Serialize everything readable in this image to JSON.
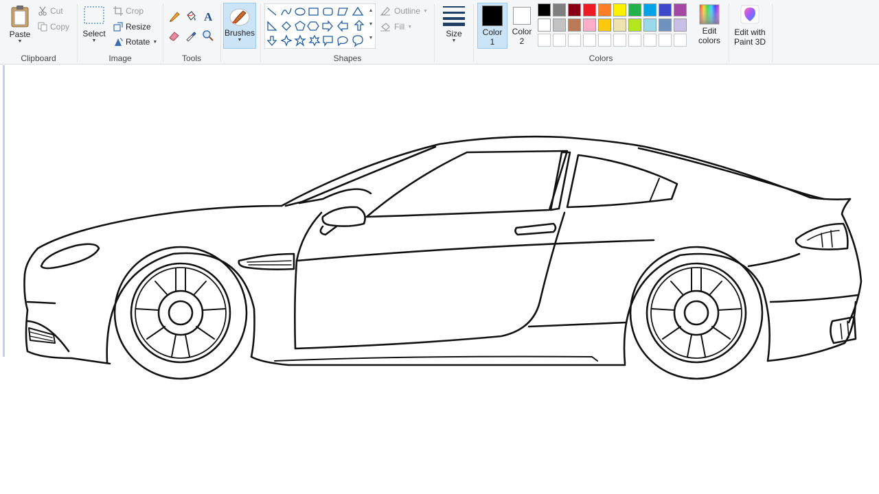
{
  "ribbon": {
    "clipboard": {
      "paste_label": "Paste",
      "cut_label": "Cut",
      "copy_label": "Copy",
      "group_label": "Clipboard"
    },
    "image": {
      "select_label": "Select",
      "crop_label": "Crop",
      "resize_label": "Resize",
      "rotate_label": "Rotate",
      "group_label": "Image"
    },
    "tools": {
      "group_label": "Tools",
      "icons": [
        "pencil-icon",
        "fill-bucket-icon",
        "text-icon",
        "eraser-icon",
        "color-picker-icon",
        "magnifier-icon"
      ]
    },
    "brushes": {
      "label": "Brushes"
    },
    "shapes": {
      "group_label": "Shapes",
      "outline_label": "Outline",
      "fill_label": "Fill"
    },
    "size": {
      "label": "Size"
    },
    "colors": {
      "color1_label": "Color",
      "color1_num": "1",
      "color2_label": "Color",
      "color2_num": "2",
      "color1_value": "#000000",
      "color2_value": "#ffffff",
      "group_label": "Colors",
      "edit_colors_line1": "Edit",
      "edit_colors_line2": "colors",
      "palette_row1": [
        "#000000",
        "#7f7f7f",
        "#880015",
        "#ed1c24",
        "#ff7f27",
        "#fff200",
        "#22b14c",
        "#00a2e8",
        "#3f48cc",
        "#a349a4"
      ],
      "palette_row2": [
        "#ffffff",
        "#c3c3c3",
        "#b97a57",
        "#ffaec9",
        "#ffc90e",
        "#efe4b0",
        "#b5e61d",
        "#99d9ea",
        "#7092be",
        "#c8bfe7"
      ]
    },
    "paint3d": {
      "line1": "Edit with",
      "line2": "Paint 3D"
    }
  }
}
